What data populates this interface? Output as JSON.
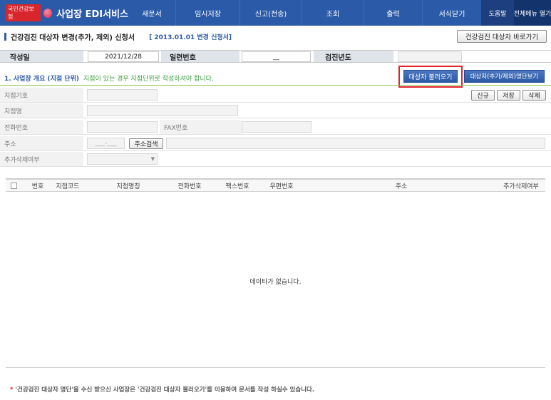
{
  "nav": {
    "org": "국민건강보험",
    "title": "사업장 EDI서비스",
    "items": [
      "새문서",
      "임시저장",
      "신고(전송)",
      "조회",
      "출력",
      "서식닫기"
    ],
    "help": "도움말",
    "all_menu": "전체메뉴 열기"
  },
  "heading": {
    "title": "건강검진 대상자 변경(추가, 제외) 신청서",
    "subtitle": "[ 2013.01.01 변경 신청서]",
    "shortcut_button": "건강검진 대상자 바로가기"
  },
  "form_top": {
    "date_label": "작성일",
    "date_value": "2021/12/28",
    "serial_label": "일련번호",
    "serial_value": "__",
    "year_label": "검진년도",
    "year_value": ""
  },
  "section1": {
    "title": "1. 사업장 개요 (지점 단위)",
    "note": "지점이 있는 경우 지점단위로 작성하셔야 합니다.",
    "load_button": "대상자 불러오기",
    "list_button": "대상자(추가/제외)명단보기",
    "new_button": "신규",
    "save_button": "저장",
    "delete_button": "삭제",
    "fields": {
      "branch_code": "지점기호",
      "branch_name": "지점명",
      "phone": "전화번호",
      "fax": "FAX번호",
      "address": "주소",
      "postal_placeholder": "___-___",
      "address_search": "주소검색",
      "add_remove": "추가삭제여부"
    }
  },
  "table": {
    "columns": [
      "번호",
      "지점코드",
      "지점명칭",
      "전화번호",
      "팩스번호",
      "우편번호",
      "주소",
      "추가삭제여부"
    ],
    "empty_message": "데이타가 없습니다."
  },
  "footnote": {
    "star": "*",
    "text": "'건강검진 대상자 명단'을 수신 받으신 사업장은 '건강검진 대상자 불러오기'를 이용하여 문서를 작성 하실수 있습니다."
  },
  "colors": {
    "nav_blue": "#2b5aa8",
    "highlight_red": "#e0222b",
    "note_green": "#3a9f3f"
  }
}
